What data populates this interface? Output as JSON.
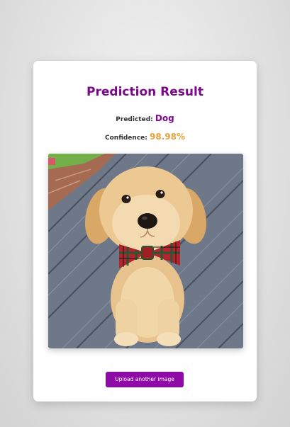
{
  "result": {
    "title": "Prediction Result",
    "predicted_label": "Predicted:",
    "predicted_value": "Dog",
    "confidence_label": "Confidence:",
    "confidence_value": "98.98%"
  },
  "image": {
    "subject": "golden retriever puppy with plaid bow tie on wooden deck"
  },
  "actions": {
    "upload_label": "Upload another image"
  },
  "colors": {
    "accent_purple": "#7b0a8a",
    "button_purple": "#8d0aa6",
    "confidence_orange": "#e8a33c"
  }
}
